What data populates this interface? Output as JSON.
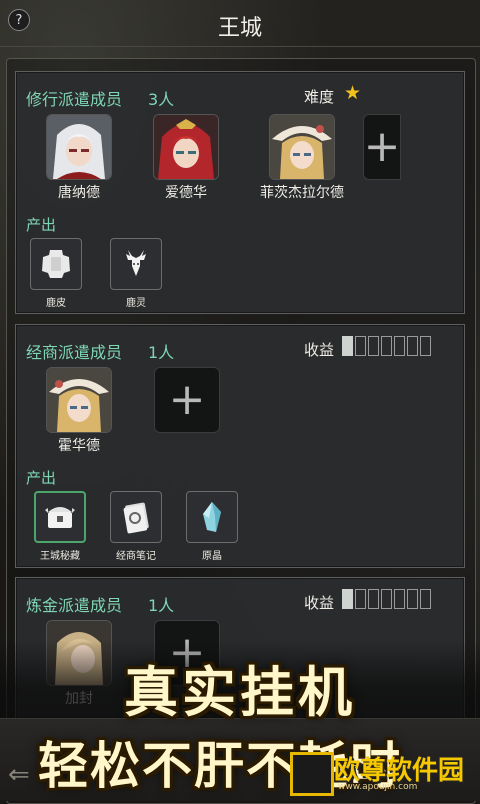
{
  "header": {
    "help": "?",
    "title": "王城"
  },
  "panels": [
    {
      "title": "修行派遣成员",
      "count": "3人",
      "right_label": "难度",
      "difficulty_stars": 1,
      "members": [
        "唐纳德",
        "爱德华",
        "菲茨杰拉尔德"
      ],
      "output_label": "产出",
      "items": [
        "鹿皮",
        "鹿灵"
      ]
    },
    {
      "title": "经商派遣成员",
      "count": "1人",
      "right_label": "收益",
      "income_level": 1,
      "income_total": 7,
      "members": [
        "霍华德"
      ],
      "output_label": "产出",
      "items": [
        "王城秘藏",
        "经商笔记",
        "原晶"
      ]
    },
    {
      "title": "炼金派遣成员",
      "count": "1人",
      "right_label": "收益",
      "income_level": 1,
      "income_total": 7,
      "members": [
        "加封"
      ]
    }
  ],
  "promo": {
    "line1": "真实挂机",
    "line2": "轻松不肝不耗时"
  },
  "watermark": {
    "text": "欧尊软件园",
    "url": "www.apoujin.com"
  },
  "colors": {
    "accent": "#7fd6b4",
    "star": "#f3c21b",
    "item_highlight": "#4ca56b"
  }
}
